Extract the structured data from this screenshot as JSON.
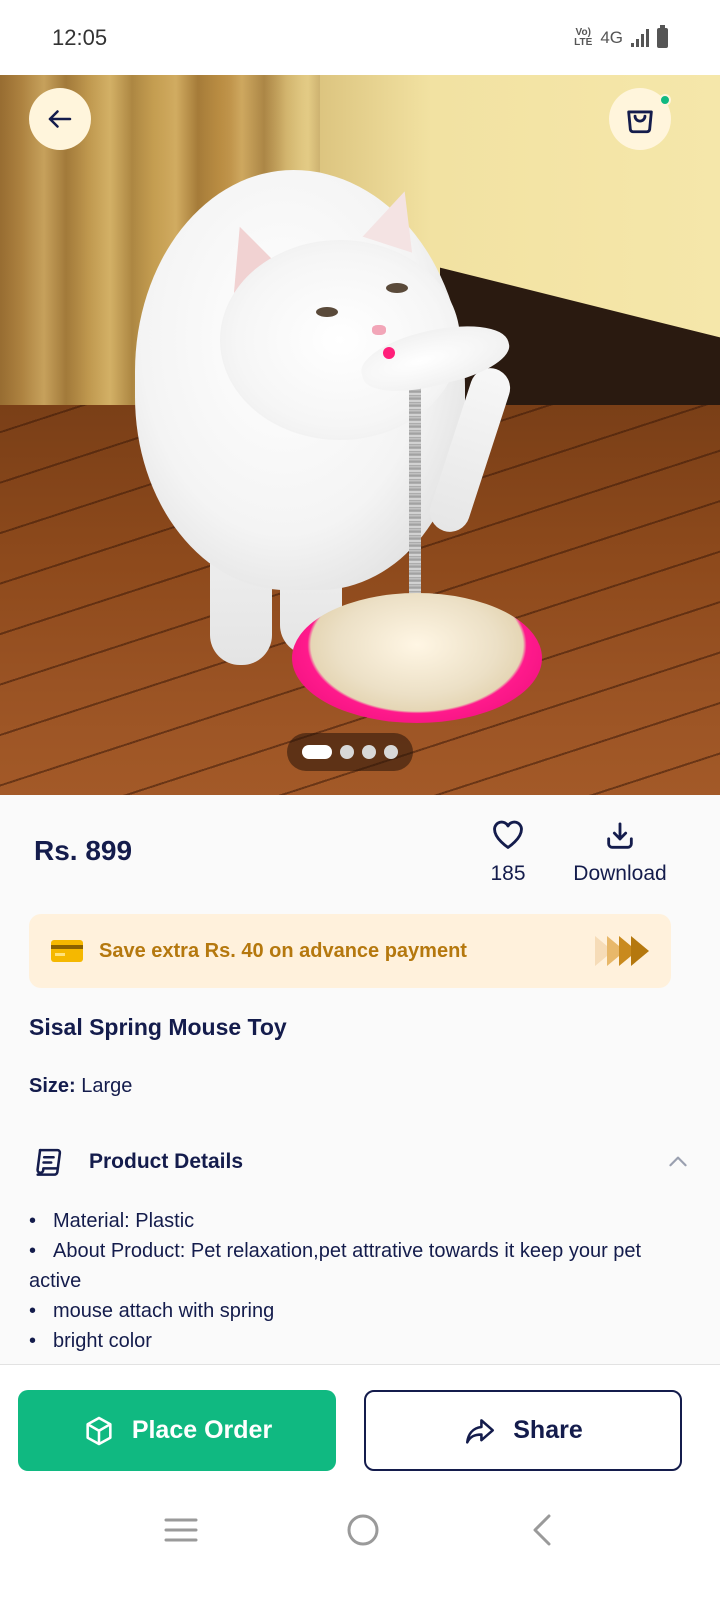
{
  "status_bar": {
    "time": "12:05",
    "volte_line1": "Vo)",
    "volte_line2": "LTE",
    "network": "4G"
  },
  "header": {
    "back_icon": "arrow-left-icon",
    "cart_icon": "shopping-bag-icon",
    "cart_has_badge": true
  },
  "gallery": {
    "image_count": 4,
    "active_index": 0
  },
  "product": {
    "price": "Rs. 899",
    "like_count": "185",
    "download_label": "Download",
    "name": "Sisal Spring Mouse Toy",
    "size_key": "Size:",
    "size_value": "Large"
  },
  "offer": {
    "text": "Save extra Rs. 40 on advance payment",
    "icon": "credit-card-icon"
  },
  "details": {
    "title": "Product Details",
    "expanded": true,
    "bullets": [
      "Material: Plastic",
      "About Product: Pet relaxation,pet attrative towards it keep your pet active",
      "mouse attach with spring",
      "bright color"
    ]
  },
  "actions": {
    "place_order": "Place Order",
    "share": "Share"
  },
  "colors": {
    "accent_green": "#10b981",
    "navy_text": "#141c4c",
    "offer_bg": "#fff1dc",
    "offer_text": "#b5780e"
  },
  "system_nav": {
    "menu_icon": "menu-icon",
    "home_icon": "home-circle-icon",
    "back_icon": "back-chevron-icon"
  }
}
